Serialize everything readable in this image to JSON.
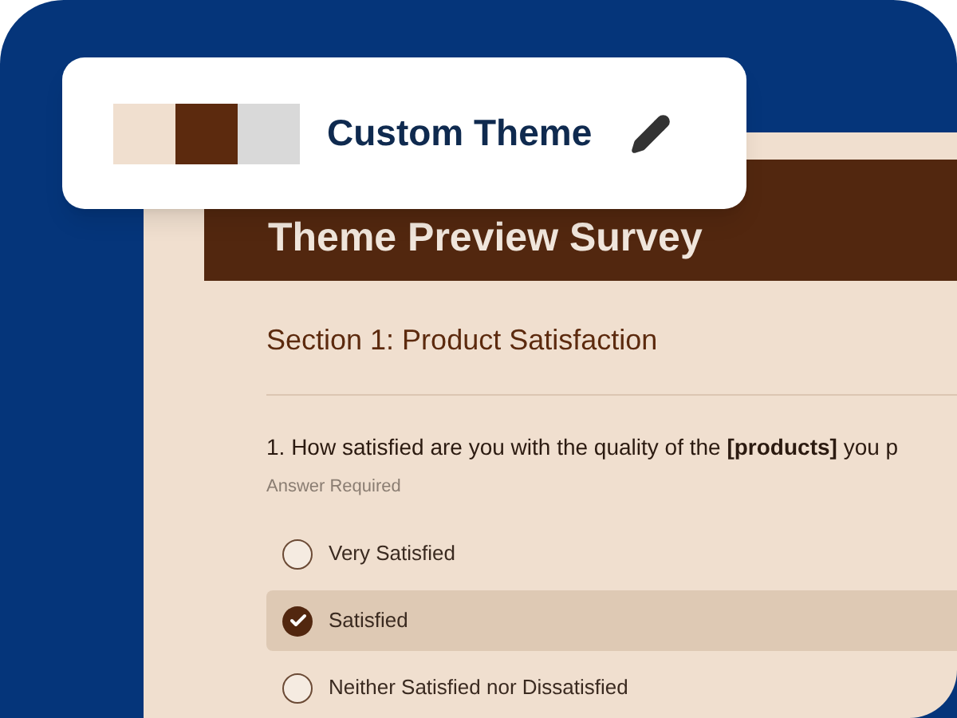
{
  "theme_card": {
    "swatches": [
      {
        "color": "#f0dfcf"
      },
      {
        "color": "#5c2a0e"
      },
      {
        "color": "#d9d9d9"
      }
    ],
    "title": "Custom Theme"
  },
  "survey": {
    "title": "Theme Preview Survey",
    "section": "Section 1: Product Satisfaction",
    "question": {
      "text": "1. How satisfied are you with the quality of the **[products]** you p",
      "note": "Answer Required",
      "options": [
        {
          "label": "Very Satisfied",
          "selected": false
        },
        {
          "label": "Satisfied",
          "selected": true
        },
        {
          "label": "Neither Satisfied nor Dissatisfied",
          "selected": false
        }
      ]
    }
  }
}
